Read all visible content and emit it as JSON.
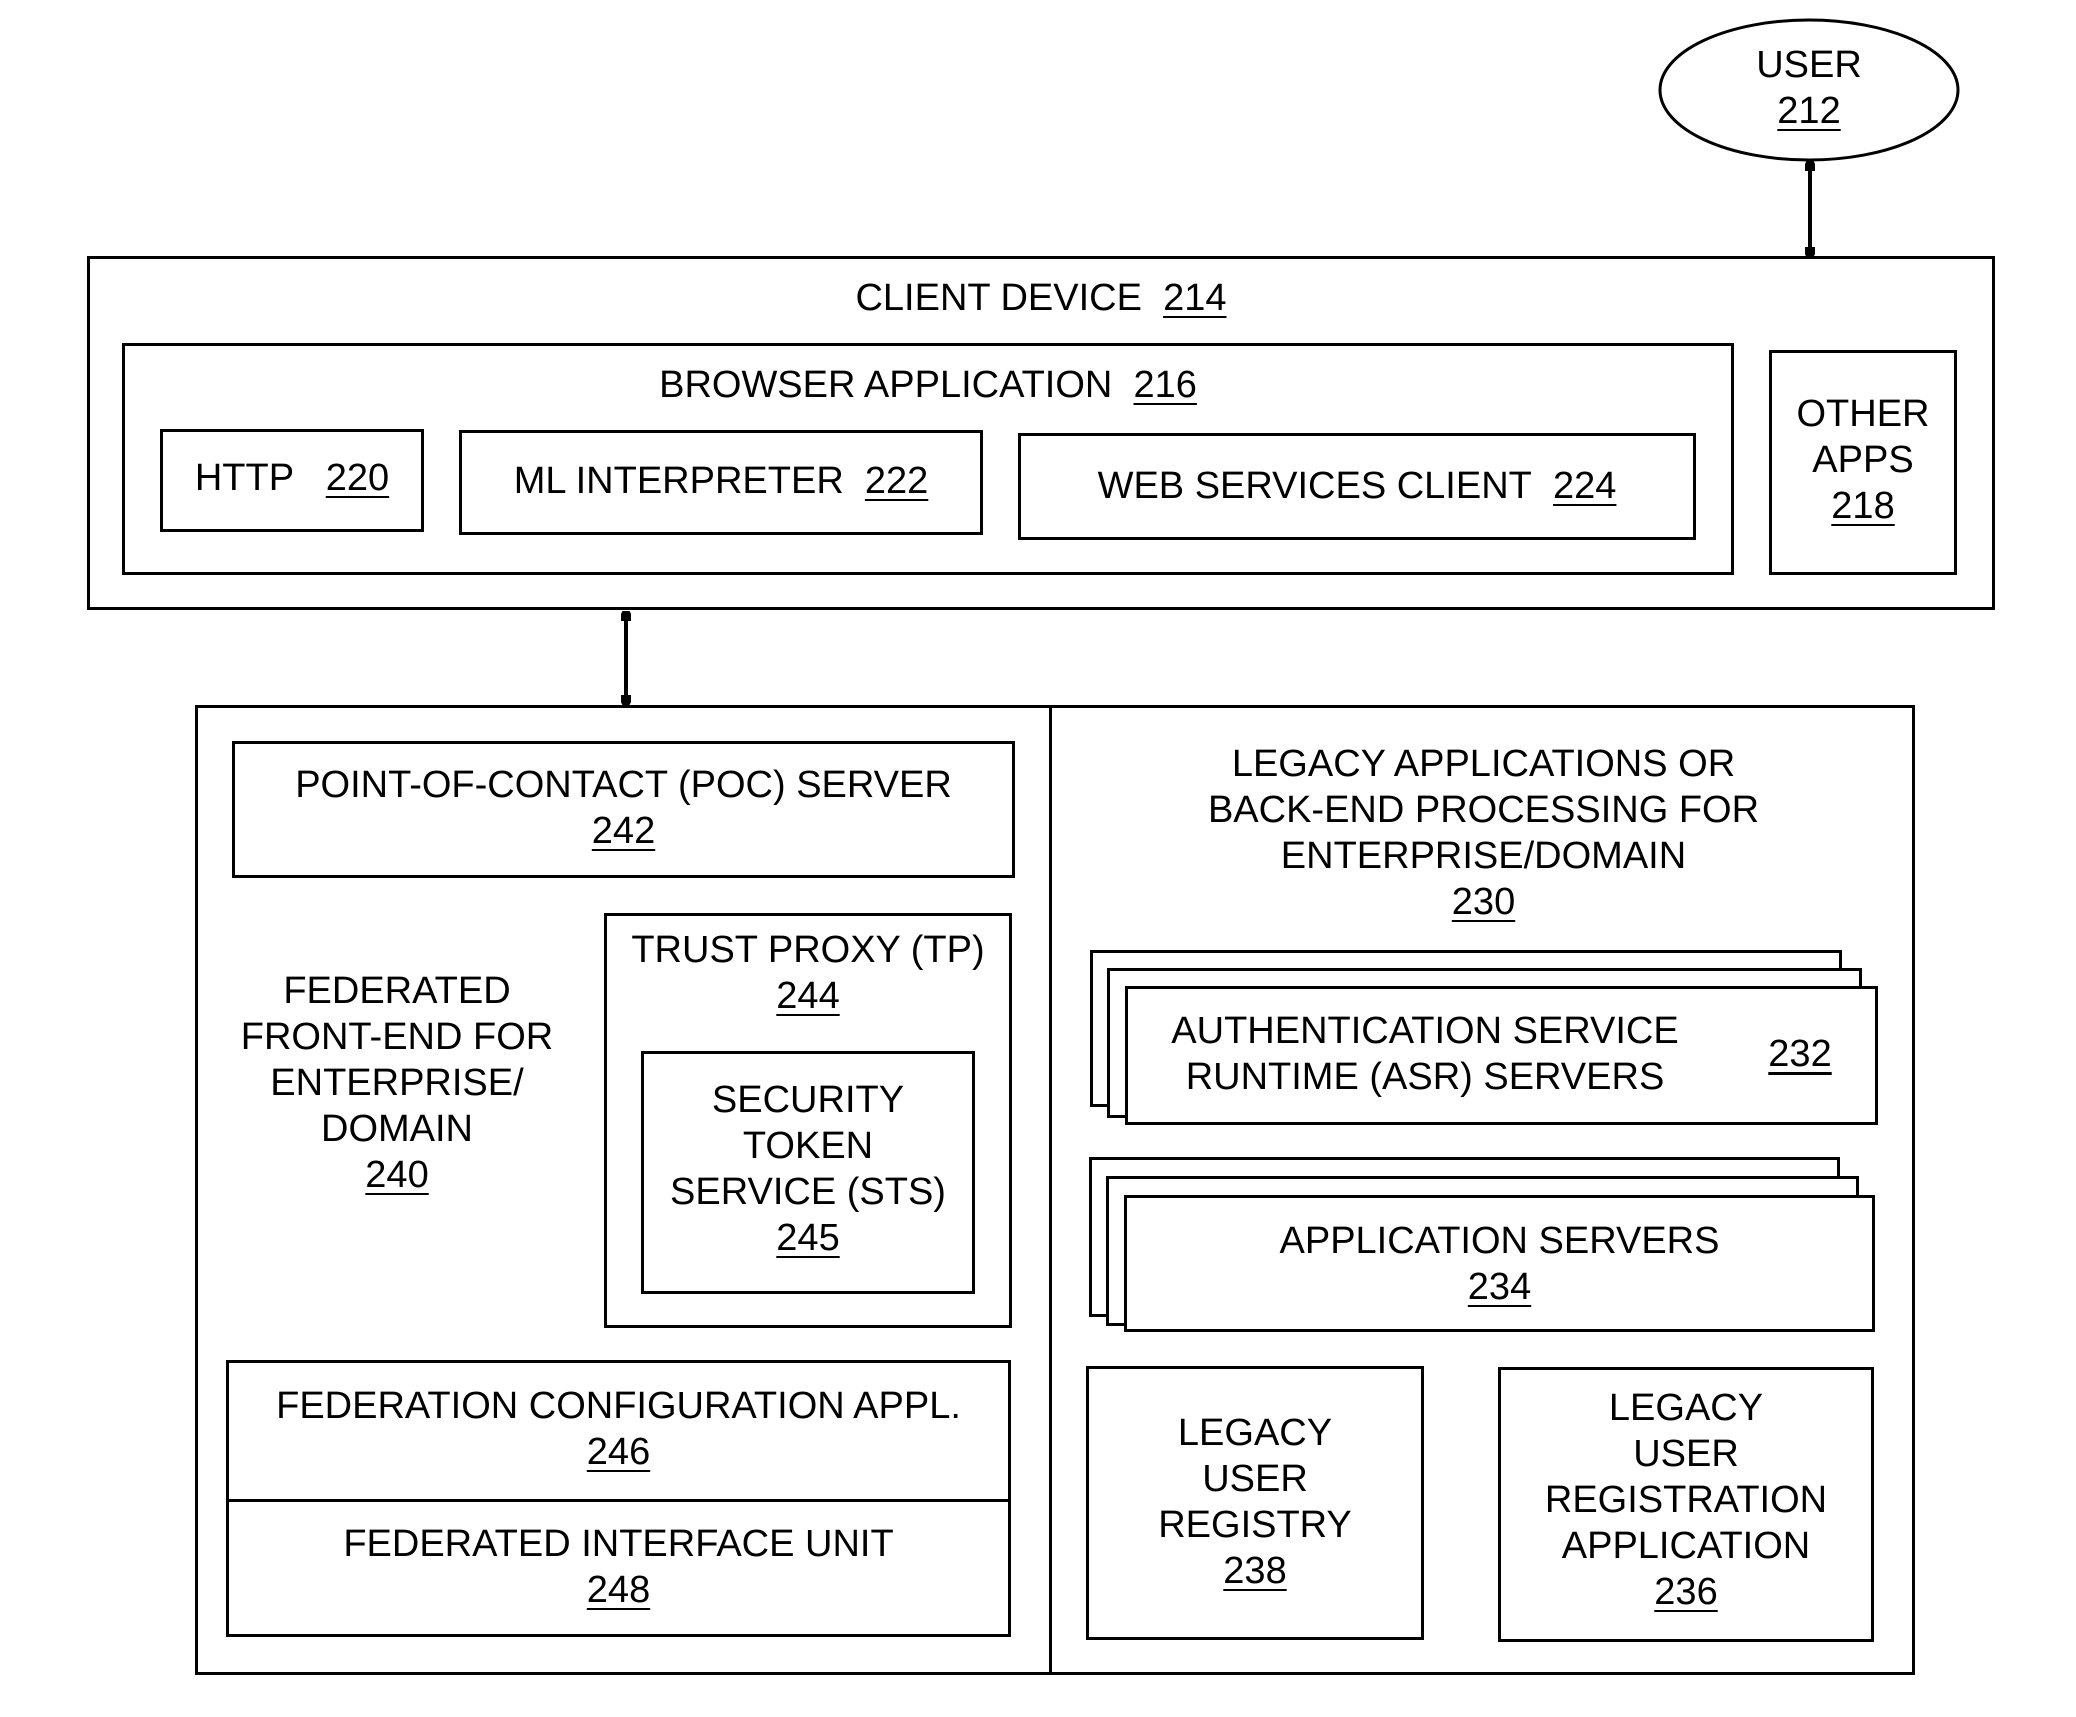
{
  "user": {
    "label": "USER",
    "ref": "212"
  },
  "client_device": {
    "label": "CLIENT DEVICE",
    "ref": "214"
  },
  "browser_application": {
    "label": "BROWSER APPLICATION",
    "ref": "216"
  },
  "http": {
    "label": "HTTP",
    "ref": "220"
  },
  "ml_interpreter": {
    "label": "ML INTERPRETER",
    "ref": "222"
  },
  "web_services_client": {
    "label": "WEB SERVICES CLIENT",
    "ref": "224"
  },
  "other_apps": {
    "lines": [
      "OTHER",
      "APPS"
    ],
    "ref": "218"
  },
  "poc_server": {
    "label": "POINT-OF-CONTACT (POC) SERVER",
    "ref": "242"
  },
  "federated_front_end": {
    "lines": [
      "FEDERATED",
      "FRONT-END FOR",
      "ENTERPRISE/",
      "DOMAIN"
    ],
    "ref": "240"
  },
  "trust_proxy": {
    "label": "TRUST PROXY (TP)",
    "ref": "244"
  },
  "sts": {
    "lines": [
      "SECURITY",
      "TOKEN",
      "SERVICE (STS)"
    ],
    "ref": "245"
  },
  "federation_config": {
    "label": "FEDERATION CONFIGURATION APPL.",
    "ref": "246"
  },
  "federated_interface_unit": {
    "label": "FEDERATED INTERFACE UNIT",
    "ref": "248"
  },
  "legacy_backend": {
    "lines": [
      "LEGACY APPLICATIONS OR",
      "BACK-END PROCESSING FOR",
      "ENTERPRISE/DOMAIN"
    ],
    "ref": "230"
  },
  "asr_servers": {
    "lines": [
      "AUTHENTICATION SERVICE",
      "RUNTIME (ASR) SERVERS"
    ],
    "ref": "232"
  },
  "application_servers": {
    "label": "APPLICATION SERVERS",
    "ref": "234"
  },
  "legacy_user_registry": {
    "lines": [
      "LEGACY",
      "USER",
      "REGISTRY"
    ],
    "ref": "238"
  },
  "legacy_user_registration_app": {
    "lines": [
      "LEGACY",
      "USER",
      "REGISTRATION",
      "APPLICATION"
    ],
    "ref": "236"
  }
}
